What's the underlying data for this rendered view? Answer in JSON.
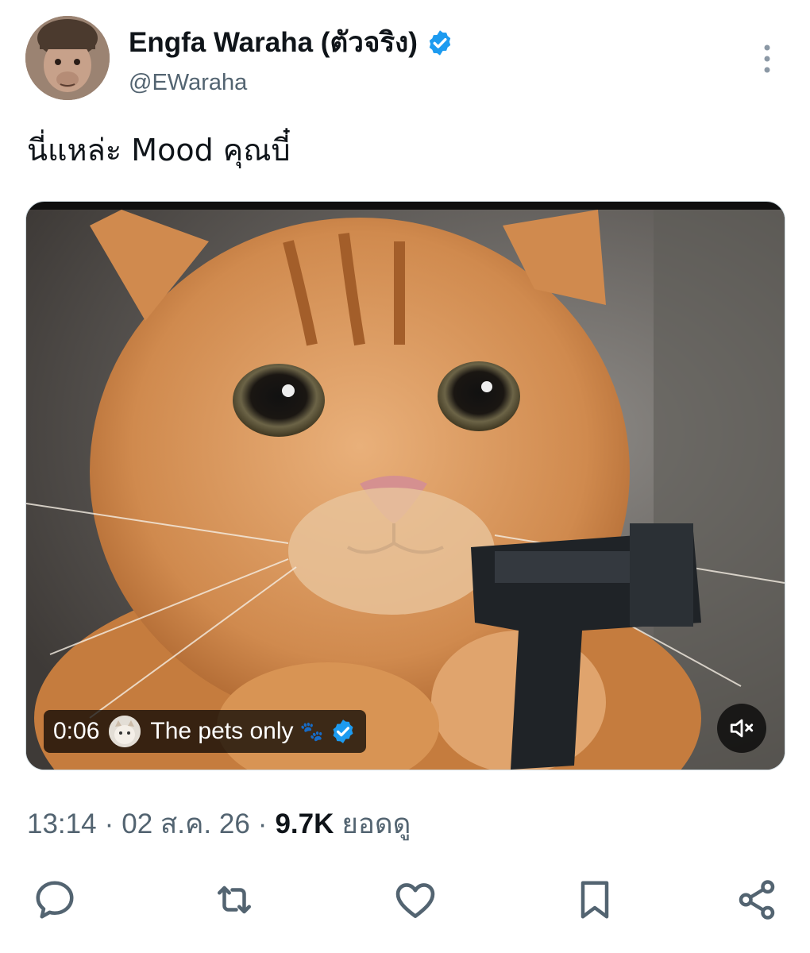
{
  "author": {
    "display_name": "Engfa Waraha (ตัวจริง)",
    "handle": "@EWaraha",
    "verified": true,
    "avatar_icon": "monkey-avatar"
  },
  "tweet": {
    "text": "นี่แหล่ะ Mood คุณบี๋"
  },
  "media": {
    "type": "video",
    "duration": "0:06",
    "source_name": "The pets only",
    "source_emoji": "🐾",
    "source_verified": true,
    "muted": true
  },
  "meta": {
    "time": "13:14",
    "date": "02 ส.ค. 26",
    "views_count": "9.7K",
    "views_label": "ยอดดู"
  },
  "actions": [
    "reply-icon",
    "retweet-icon",
    "like-icon",
    "bookmark-icon",
    "share-icon"
  ],
  "colors": {
    "verified_blue": "#1d9bf0",
    "secondary_text": "#536471",
    "primary_text": "#0f1419"
  }
}
